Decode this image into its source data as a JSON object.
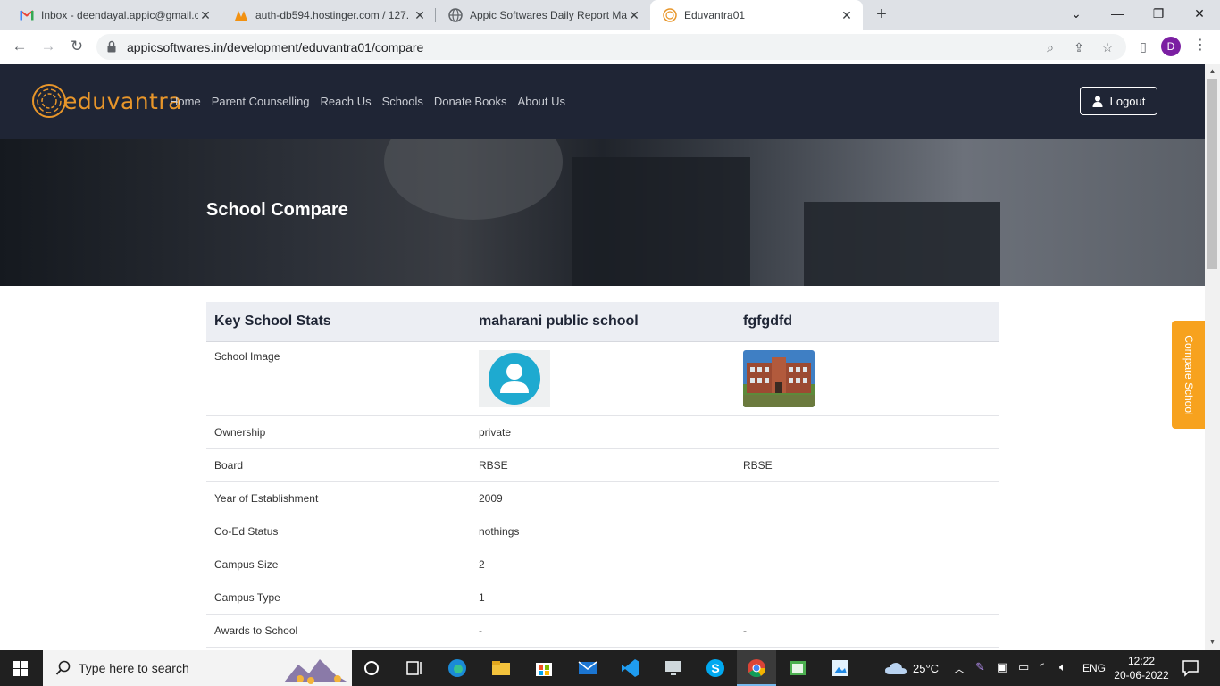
{
  "browser": {
    "tabs": [
      {
        "title": "Inbox - deendayal.appic@gmail.c",
        "icon": "gmail-icon"
      },
      {
        "title": "auth-db594.hostinger.com / 127.",
        "icon": "phpmyadmin-icon"
      },
      {
        "title": "Appic Softwares Daily Report Ma",
        "icon": "globe-icon"
      },
      {
        "title": "Eduvantra01",
        "icon": "eduvantra-icon"
      }
    ],
    "url": "appicsoftwares.in/development/eduvantra01/compare",
    "profile_initial": "D"
  },
  "site": {
    "logo_text": "eduvantra",
    "menu": [
      "Home",
      "Parent Counselling",
      "Reach Us",
      "Schools",
      "Donate Books",
      "About Us"
    ],
    "logout_label": "Logout",
    "hero_title": "School Compare",
    "compare_tab_label": "Compare School"
  },
  "compare": {
    "headers": [
      "Key School Stats",
      "maharani public school",
      "fgfgdfd"
    ],
    "image_row_label": "School Image",
    "rows": [
      {
        "label": "Ownership",
        "a": "private",
        "b": ""
      },
      {
        "label": "Board",
        "a": "RBSE",
        "b": "RBSE"
      },
      {
        "label": "Year of Establishment",
        "a": "2009",
        "b": ""
      },
      {
        "label": "Co-Ed Status",
        "a": "nothings",
        "b": ""
      },
      {
        "label": "Campus Size",
        "a": "2",
        "b": ""
      },
      {
        "label": "Campus Type",
        "a": "1",
        "b": ""
      },
      {
        "label": "Awards to School",
        "a": "-",
        "b": "-"
      }
    ]
  },
  "taskbar": {
    "search_placeholder": "Type here to search",
    "weather": "25°C",
    "lang": "ENG",
    "time": "12:22",
    "date": "20-06-2022"
  },
  "colors": {
    "nav_bg": "#1f2535",
    "accent_orange": "#f7a21e",
    "logo_orange": "#e8962a",
    "table_header_bg": "#eceef3"
  }
}
